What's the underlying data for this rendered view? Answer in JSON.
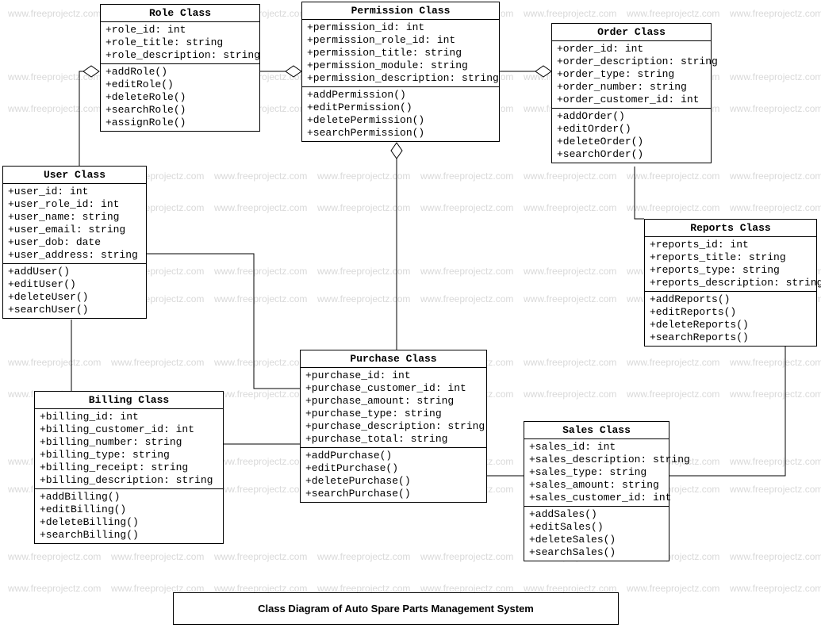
{
  "diagram_title": "Class Diagram of Auto Spare Parts Management System",
  "watermark_text": "www.freeprojectz.com",
  "classes": {
    "role": {
      "title": "Role Class",
      "attrs": [
        "+role_id: int",
        "+role_title: string",
        "+role_description: string"
      ],
      "ops": [
        "+addRole()",
        "+editRole()",
        "+deleteRole()",
        "+searchRole()",
        "+assignRole()"
      ]
    },
    "permission": {
      "title": "Permission Class",
      "attrs": [
        "+permission_id: int",
        "+permission_role_id: int",
        "+permission_title: string",
        "+permission_module: string",
        "+permission_description: string"
      ],
      "ops": [
        "+addPermission()",
        "+editPermission()",
        "+deletePermission()",
        "+searchPermission()"
      ]
    },
    "order": {
      "title": "Order Class",
      "attrs": [
        "+order_id: int",
        "+order_description: string",
        "+order_type: string",
        "+order_number: string",
        "+order_customer_id: int"
      ],
      "ops": [
        "+addOrder()",
        "+editOrder()",
        "+deleteOrder()",
        "+searchOrder()"
      ]
    },
    "user": {
      "title": "User Class",
      "attrs": [
        "+user_id: int",
        "+user_role_id: int",
        "+user_name: string",
        "+user_email: string",
        "+user_dob: date",
        "+user_address: string"
      ],
      "ops": [
        "+addUser()",
        "+editUser()",
        "+deleteUser()",
        "+searchUser()"
      ]
    },
    "reports": {
      "title": "Reports Class",
      "attrs": [
        "+reports_id: int",
        "+reports_title: string",
        "+reports_type: string",
        "+reports_description: string"
      ],
      "ops": [
        "+addReports()",
        "+editReports()",
        "+deleteReports()",
        "+searchReports()"
      ]
    },
    "purchase": {
      "title": "Purchase Class",
      "attrs": [
        "+purchase_id: int",
        "+purchase_customer_id: int",
        "+purchase_amount: string",
        "+purchase_type: string",
        "+purchase_description: string",
        "+purchase_total: string"
      ],
      "ops": [
        "+addPurchase()",
        "+editPurchase()",
        "+deletePurchase()",
        "+searchPurchase()"
      ]
    },
    "billing": {
      "title": "Billing Class",
      "attrs": [
        "+billing_id: int",
        "+billing_customer_id: int",
        "+billing_number: string",
        "+billing_type: string",
        "+billing_receipt: string",
        "+billing_description: string"
      ],
      "ops": [
        "+addBilling()",
        "+editBilling()",
        "+deleteBilling()",
        "+searchBilling()"
      ]
    },
    "sales": {
      "title": "Sales Class",
      "attrs": [
        "+sales_id: int",
        "+sales_description: string",
        "+sales_type: string",
        "+sales_amount: string",
        "+sales_customer_id: int"
      ],
      "ops": [
        "+addSales()",
        "+editSales()",
        "+deleteSales()",
        "+searchSales()"
      ]
    }
  },
  "relationships": [
    {
      "from": "user",
      "to": "role",
      "type": "aggregation"
    },
    {
      "from": "role",
      "to": "permission",
      "type": "aggregation"
    },
    {
      "from": "permission",
      "to": "order",
      "type": "aggregation"
    },
    {
      "from": "permission",
      "to": "purchase",
      "type": "aggregation"
    },
    {
      "from": "user",
      "to": "purchase",
      "type": "association"
    },
    {
      "from": "user",
      "to": "billing",
      "type": "association"
    },
    {
      "from": "purchase",
      "to": "billing",
      "type": "association"
    },
    {
      "from": "purchase",
      "to": "sales",
      "type": "association"
    },
    {
      "from": "order",
      "to": "reports",
      "type": "association"
    },
    {
      "from": "sales",
      "to": "reports",
      "type": "association"
    }
  ]
}
